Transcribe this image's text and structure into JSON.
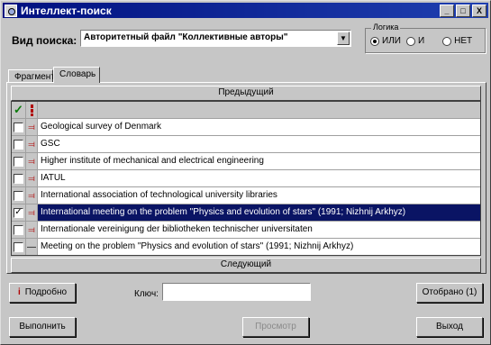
{
  "window": {
    "title": "Интеллект-поиск",
    "controls": {
      "minimize": "_",
      "maximize": "□",
      "close": "X"
    }
  },
  "search": {
    "label": "Вид поиска:",
    "selected": "Авторитетный файл \"Коллективные авторы\"",
    "dropdown_glyph": "▼"
  },
  "logic": {
    "legend": "Логика",
    "options": [
      {
        "label": "ИЛИ",
        "selected": true
      },
      {
        "label": "И",
        "selected": false
      },
      {
        "label": "НЕТ",
        "selected": false
      }
    ]
  },
  "tabs": [
    {
      "label": "Фрагмент",
      "active": false
    },
    {
      "label": "Словарь",
      "active": true
    }
  ],
  "list": {
    "prev_label": "Предыдущий",
    "next_label": "Следующий",
    "header_check_icon": "✓",
    "header_flag_icon": "flag-icon",
    "rows": [
      {
        "text": "Geological survey of Denmark",
        "checked": false,
        "selected": false,
        "icon": "red-branch-icon"
      },
      {
        "text": "GSC",
        "checked": false,
        "selected": false,
        "icon": "red-branch-icon"
      },
      {
        "text": "Higher institute of mechanical and electrical engineering",
        "checked": false,
        "selected": false,
        "icon": "red-branch-icon"
      },
      {
        "text": "IATUL",
        "checked": false,
        "selected": false,
        "icon": "red-branch-icon"
      },
      {
        "text": "International association of technological university libraries",
        "checked": false,
        "selected": false,
        "icon": "red-branch-icon"
      },
      {
        "text": "International meeting on the problem \"Physics and evolution of stars\" (1991; Nizhnij Arkhyz)",
        "checked": true,
        "selected": true,
        "icon": "red-branch-icon"
      },
      {
        "text": "Internationale vereinigung der bibliotheken technischer universitaten",
        "checked": false,
        "selected": false,
        "icon": "red-branch-icon"
      },
      {
        "text": "Meeting on the problem \"Physics and evolution of stars\" (1991; Nizhnij Arkhyz)",
        "checked": false,
        "selected": false,
        "icon": "dash-icon"
      }
    ]
  },
  "bottom": {
    "full_button": "Подробно",
    "key_label": "Ключ:",
    "key_value": "",
    "selected_button": "Отобрано (1)",
    "run_button": "Выполнить",
    "view_button": "Просмотр",
    "exit_button": "Выход"
  },
  "colors": {
    "title_bar": "#00107f",
    "selection": "#0a1464",
    "icon_red": "#b00000"
  }
}
